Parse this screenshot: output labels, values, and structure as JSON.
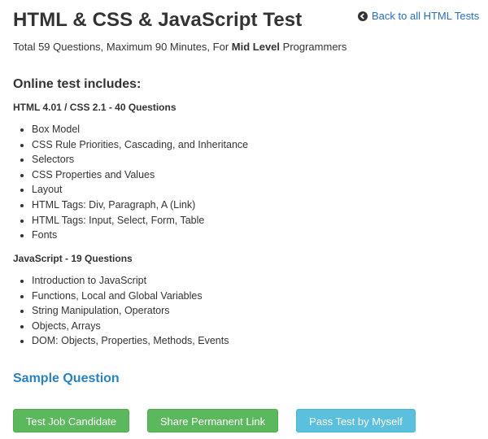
{
  "header": {
    "title": "HTML & CSS & JavaScript Test",
    "back_link": "Back to all HTML Tests",
    "subtitle_prefix": "Total 59 Questions, Maximum 90 Minutes, For ",
    "subtitle_level": "Mid Level",
    "subtitle_suffix": " Programmers"
  },
  "includes_heading": "Online test includes:",
  "sections": [
    {
      "heading": "HTML 4.01 / CSS 2.1  -  40 Questions",
      "topics": [
        "Box Model",
        "CSS Rule Priorities, Cascading, and Inheritance",
        "Selectors",
        "CSS Properties and Values",
        "Layout",
        "HTML Tags: Div, Paragraph, A (Link)",
        "HTML Tags: Input, Select, Form, Table",
        "Fonts"
      ]
    },
    {
      "heading": "JavaScript  -  19 Questions",
      "topics": [
        "Introduction to JavaScript",
        "Functions, Local and Global Variables",
        "String Manipulation, Operators",
        "Objects, Arrays",
        "DOM: Objects, Properties, Methods, Events"
      ]
    }
  ],
  "sample_question": "Sample Question",
  "buttons": {
    "test_candidate": "Test Job Candidate",
    "share_link": "Share Permanent Link",
    "pass_test": "Pass Test by Myself"
  },
  "colors": {
    "green_button": "#5cb85c",
    "blue_button": "#5bc0de",
    "link": "#2a6ebb"
  },
  "icons": {
    "back": "arrow-left-circle-icon"
  }
}
